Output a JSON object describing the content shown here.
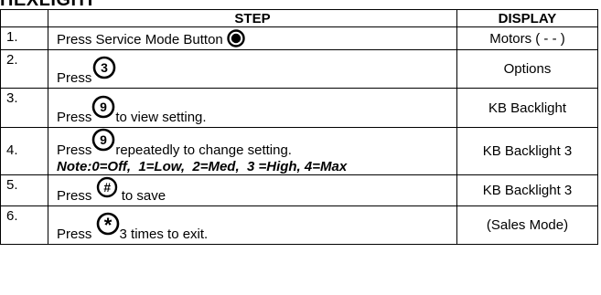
{
  "title": "HEXLIGHT",
  "headers": {
    "step": "STEP",
    "display": "DISPLAY"
  },
  "rows": [
    {
      "num": "1.",
      "text_before": "Press Service Mode Button",
      "icon": "service-mode-icon",
      "display": "Motors ( - - )"
    },
    {
      "num": "2.",
      "text_before": "Press",
      "icon": "key-3-icon",
      "key_label": "3",
      "display": "Options"
    },
    {
      "num": "3.",
      "text_before": "Press",
      "icon": "key-9-icon",
      "key_label": "9",
      "text_after": "to view setting.",
      "display": "KB Backlight"
    },
    {
      "num": "4.",
      "text_before": "Press",
      "icon": "key-9-icon",
      "key_label": "9",
      "text_after": "repeatedly to change setting.",
      "note": "Note:0=Off,  1=Low,  2=Med,  3 =High, 4=Max",
      "display": "KB Backlight 3"
    },
    {
      "num": "5.",
      "text_before": "Press",
      "icon": "key-hash-icon",
      "key_label": "#",
      "text_after": "to save",
      "display": "KB Backlight 3"
    },
    {
      "num": "6.",
      "text_before": "Press",
      "icon": "key-star-icon",
      "key_label": "*",
      "text_after": "3 times to exit.",
      "display": "(Sales Mode)"
    }
  ]
}
